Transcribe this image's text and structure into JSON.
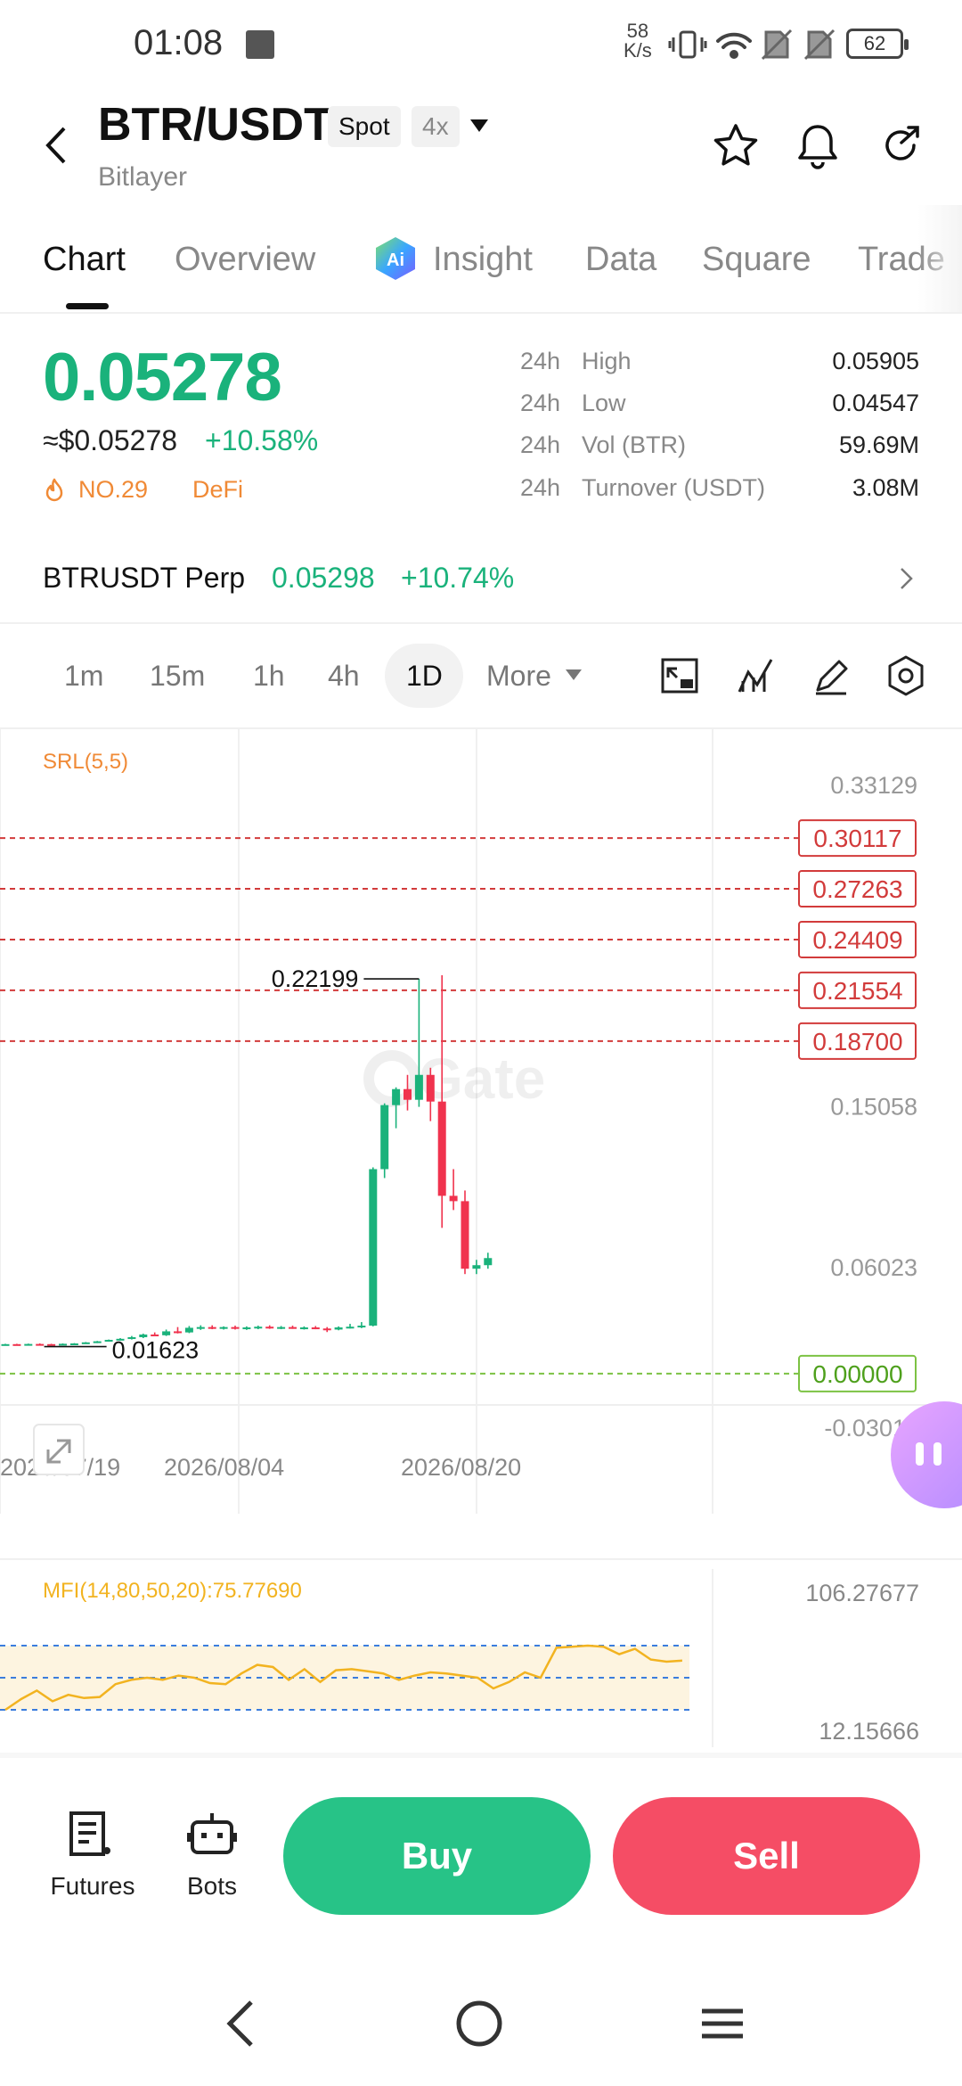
{
  "status": {
    "time": "01:08",
    "net_speed_value": "58",
    "net_speed_unit": "K/s",
    "battery": "62"
  },
  "header": {
    "pair": "BTR/USDT",
    "market_tag": "Spot",
    "leverage_tag": "4x",
    "project": "Bitlayer"
  },
  "tabs": [
    {
      "label": "Chart",
      "active": true
    },
    {
      "label": "Overview"
    },
    {
      "label": "Insight"
    },
    {
      "label": "Data"
    },
    {
      "label": "Square"
    },
    {
      "label": "Trade"
    }
  ],
  "price": {
    "last": "0.05278",
    "usd": "≈$0.05278",
    "change": "+10.58%",
    "rank": "NO.29",
    "sector": "DeFi",
    "stats": [
      {
        "period": "24h",
        "name": "High",
        "value": "0.05905"
      },
      {
        "period": "24h",
        "name": "Low",
        "value": "0.04547"
      },
      {
        "period": "24h",
        "name": "Vol (BTR)",
        "value": "59.69M"
      },
      {
        "period": "24h",
        "name": "Turnover (USDT)",
        "value": "3.08M"
      }
    ]
  },
  "perp": {
    "name": "BTRUSDT Perp",
    "price": "0.05298",
    "change": "+10.74%"
  },
  "intervals": [
    "1m",
    "15m",
    "1h",
    "4h",
    "1D"
  ],
  "interval_selected": "1D",
  "more_label": "More",
  "colors": {
    "up": "#1ab27b",
    "down": "#f0334e",
    "accent_orange": "#f08a36",
    "level_red": "#d23b3b",
    "mfi_line": "#f2b320"
  },
  "chart_data": {
    "type": "candlestick",
    "indicator_label": "SRL(5,5)",
    "y_axis_ticks": [
      "0.33129",
      "0.15058",
      "0.06023",
      "-0.03011"
    ],
    "resistance_levels": [
      "0.30117",
      "0.27263",
      "0.24409",
      "0.21554",
      "0.18700"
    ],
    "support_level": "0.00000",
    "high_marker": "0.22199",
    "low_marker": "0.01623",
    "x_axis_ticks": [
      "2026/07/19",
      "2026/08/04",
      "2026/08/20"
    ],
    "ylim": [
      -0.03011,
      0.33129
    ],
    "candles": [
      {
        "o": 0.0165,
        "h": 0.0168,
        "l": 0.0162,
        "c": 0.0166
      },
      {
        "o": 0.0166,
        "h": 0.0168,
        "l": 0.0163,
        "c": 0.0165
      },
      {
        "o": 0.0165,
        "h": 0.0169,
        "l": 0.0163,
        "c": 0.0167
      },
      {
        "o": 0.0167,
        "h": 0.017,
        "l": 0.0164,
        "c": 0.0166
      },
      {
        "o": 0.0166,
        "h": 0.0168,
        "l": 0.01623,
        "c": 0.0164
      },
      {
        "o": 0.0164,
        "h": 0.017,
        "l": 0.0163,
        "c": 0.0168
      },
      {
        "o": 0.0168,
        "h": 0.0172,
        "l": 0.0165,
        "c": 0.017
      },
      {
        "o": 0.017,
        "h": 0.0178,
        "l": 0.0168,
        "c": 0.0176
      },
      {
        "o": 0.0176,
        "h": 0.0184,
        "l": 0.0172,
        "c": 0.0182
      },
      {
        "o": 0.0182,
        "h": 0.0192,
        "l": 0.018,
        "c": 0.019
      },
      {
        "o": 0.019,
        "h": 0.02,
        "l": 0.0186,
        "c": 0.0196
      },
      {
        "o": 0.0196,
        "h": 0.0212,
        "l": 0.0192,
        "c": 0.0205
      },
      {
        "o": 0.0205,
        "h": 0.0225,
        "l": 0.02,
        "c": 0.022
      },
      {
        "o": 0.022,
        "h": 0.0232,
        "l": 0.0212,
        "c": 0.0216
      },
      {
        "o": 0.0216,
        "h": 0.0248,
        "l": 0.0212,
        "c": 0.0238
      },
      {
        "o": 0.0238,
        "h": 0.0262,
        "l": 0.0226,
        "c": 0.0232
      },
      {
        "o": 0.0232,
        "h": 0.0268,
        "l": 0.0228,
        "c": 0.0258
      },
      {
        "o": 0.0258,
        "h": 0.0272,
        "l": 0.0246,
        "c": 0.0262
      },
      {
        "o": 0.0262,
        "h": 0.0272,
        "l": 0.025,
        "c": 0.0256
      },
      {
        "o": 0.0256,
        "h": 0.0266,
        "l": 0.0248,
        "c": 0.0262
      },
      {
        "o": 0.0262,
        "h": 0.027,
        "l": 0.0248,
        "c": 0.0254
      },
      {
        "o": 0.0254,
        "h": 0.0266,
        "l": 0.0246,
        "c": 0.026
      },
      {
        "o": 0.026,
        "h": 0.027,
        "l": 0.025,
        "c": 0.0264
      },
      {
        "o": 0.0264,
        "h": 0.0272,
        "l": 0.0252,
        "c": 0.0258
      },
      {
        "o": 0.0258,
        "h": 0.0268,
        "l": 0.025,
        "c": 0.0262
      },
      {
        "o": 0.0262,
        "h": 0.027,
        "l": 0.0252,
        "c": 0.0256
      },
      {
        "o": 0.0256,
        "h": 0.0266,
        "l": 0.0248,
        "c": 0.026
      },
      {
        "o": 0.026,
        "h": 0.0268,
        "l": 0.025,
        "c": 0.0254
      },
      {
        "o": 0.0254,
        "h": 0.0262,
        "l": 0.0234,
        "c": 0.0248
      },
      {
        "o": 0.0248,
        "h": 0.0266,
        "l": 0.0244,
        "c": 0.026
      },
      {
        "o": 0.026,
        "h": 0.028,
        "l": 0.0254,
        "c": 0.0264
      },
      {
        "o": 0.0264,
        "h": 0.029,
        "l": 0.0256,
        "c": 0.027
      },
      {
        "o": 0.027,
        "h": 0.116,
        "l": 0.0266,
        "c": 0.115
      },
      {
        "o": 0.115,
        "h": 0.152,
        "l": 0.11,
        "c": 0.151
      },
      {
        "o": 0.151,
        "h": 0.161,
        "l": 0.138,
        "c": 0.16
      },
      {
        "o": 0.16,
        "h": 0.168,
        "l": 0.148,
        "c": 0.154
      },
      {
        "o": 0.154,
        "h": 0.22199,
        "l": 0.15,
        "c": 0.168
      },
      {
        "o": 0.168,
        "h": 0.172,
        "l": 0.142,
        "c": 0.153
      },
      {
        "o": 0.153,
        "h": 0.224,
        "l": 0.082,
        "c": 0.1
      },
      {
        "o": 0.1,
        "h": 0.115,
        "l": 0.092,
        "c": 0.097
      },
      {
        "o": 0.097,
        "h": 0.103,
        "l": 0.056,
        "c": 0.059
      },
      {
        "o": 0.059,
        "h": 0.064,
        "l": 0.056,
        "c": 0.061
      },
      {
        "o": 0.061,
        "h": 0.068,
        "l": 0.059,
        "c": 0.065
      }
    ]
  },
  "mfi": {
    "label": "MFI(14,80,50,20):75.77690",
    "top_value": "106.27677",
    "bottom_value": "12.15666",
    "values": [
      20,
      30,
      38,
      28,
      34,
      31,
      32,
      44,
      48,
      50,
      48,
      52,
      50,
      45,
      44,
      54,
      62,
      60,
      48,
      58,
      46,
      57,
      58,
      56,
      54,
      48,
      52,
      55,
      54,
      52,
      50,
      40,
      46,
      55,
      50,
      78,
      79,
      80,
      79,
      72,
      77,
      67,
      65,
      66
    ]
  },
  "bottom": {
    "futures": "Futures",
    "bots": "Bots",
    "buy": "Buy",
    "sell": "Sell"
  }
}
